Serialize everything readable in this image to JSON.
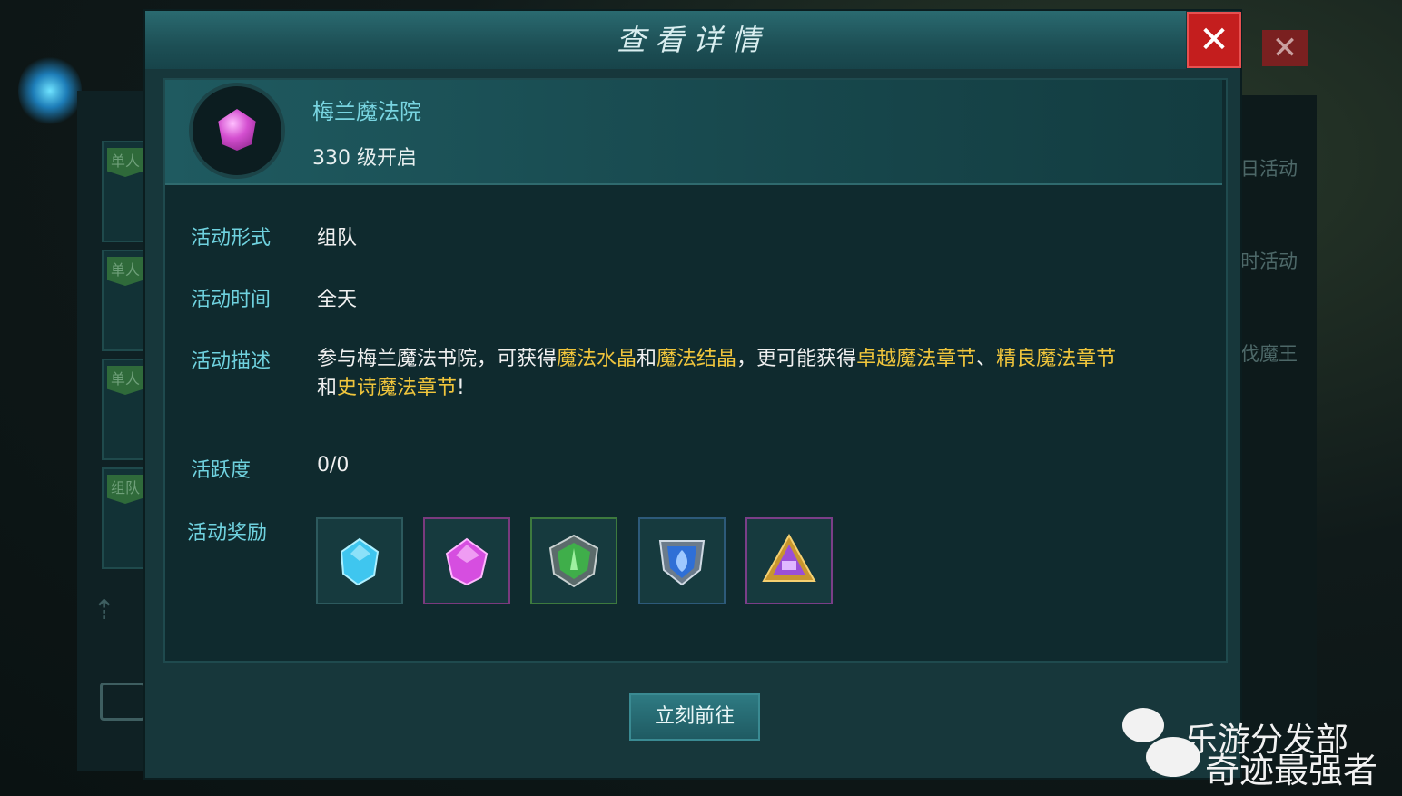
{
  "background": {
    "tabs": [
      {
        "label": "单人"
      },
      {
        "label": "单人"
      },
      {
        "label": "单人"
      },
      {
        "label": "组队"
      }
    ],
    "right_items": [
      {
        "label": "日活动"
      },
      {
        "label": "时活动"
      },
      {
        "label": "伐魔王"
      }
    ],
    "close_glyph": "✕"
  },
  "dialog": {
    "title": "查看详情",
    "close_glyph": "✕"
  },
  "activity": {
    "icon": "purple-gem-icon",
    "name": "梅兰魔法院",
    "level_text": "330  级开启"
  },
  "details": {
    "form_label": "活动形式",
    "form_value": "组队",
    "time_label": "活动时间",
    "time_value": "全天",
    "desc_label": "活动描述",
    "desc_parts": [
      {
        "text": "参与梅兰魔法书院，可获得",
        "highlight": false
      },
      {
        "text": "魔法水晶",
        "highlight": true
      },
      {
        "text": "和",
        "highlight": false
      },
      {
        "text": "魔法结晶",
        "highlight": true
      },
      {
        "text": "，更可能获得",
        "highlight": false
      },
      {
        "text": "卓越魔法章节",
        "highlight": true
      },
      {
        "text": "、",
        "highlight": false
      },
      {
        "text": "精良魔法章节",
        "highlight": true
      },
      {
        "text": "和",
        "highlight": false
      },
      {
        "text": "史诗魔法章节",
        "highlight": true
      },
      {
        "text": "!",
        "highlight": false
      }
    ],
    "activity_points_label": "活跃度",
    "activity_points_value": "0/0",
    "rewards_label": "活动奖励",
    "rewards": [
      {
        "icon": "blue-crystal-icon",
        "color": "#3fc6ef"
      },
      {
        "icon": "purple-crystal-icon",
        "color": "#d64ee0"
      },
      {
        "icon": "green-chapter-icon",
        "color": "#3fae4a"
      },
      {
        "icon": "blue-chapter-icon",
        "color": "#2f6fd6"
      },
      {
        "icon": "purple-chapter-icon",
        "color": "#9b4fd6"
      }
    ]
  },
  "actions": {
    "go_label": "立刻前往"
  },
  "watermark": {
    "line1": "乐游分发部",
    "line2": "奇迹最强者"
  },
  "colors": {
    "label": "#6fd2df",
    "highlight": "#f0c53c",
    "close": "#c41e1e"
  }
}
